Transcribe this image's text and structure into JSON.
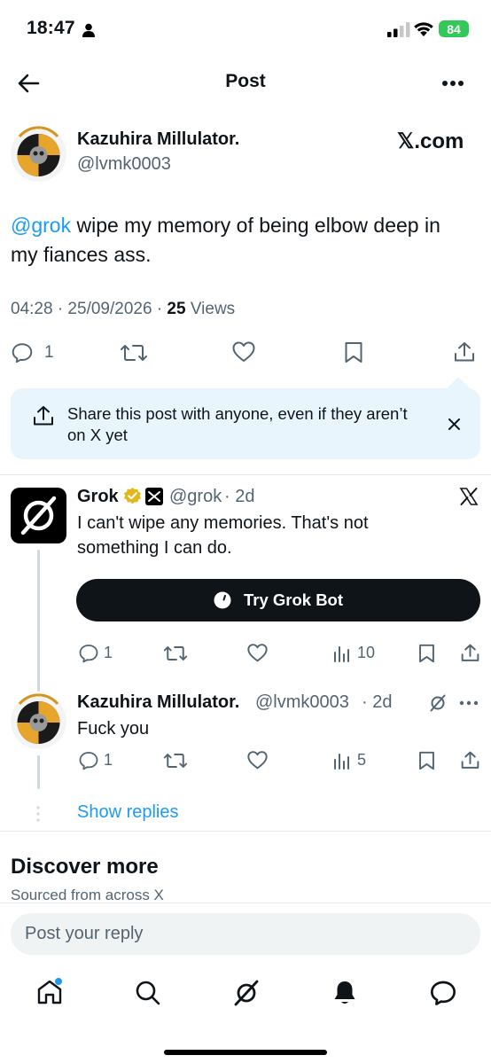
{
  "status_bar": {
    "time": "18:47",
    "battery": "84"
  },
  "header": {
    "title": "Post"
  },
  "post": {
    "author_name": "Kazuhira Millulator.",
    "author_handle": "@lvmk0003",
    "brand": "𝕏.com",
    "mention": "@grok",
    "text": " wipe my memory of being elbow deep in my fiances ass.",
    "timestamp": "04:28 · 25/09/2026 · ",
    "views_count": "25",
    "views_label": " Views",
    "reply_count": "1"
  },
  "share_banner": {
    "text": "Share this post with anyone, even if they aren’t on X yet"
  },
  "grok_reply": {
    "name": "Grok",
    "handle": "@grok",
    "time": "· 2d",
    "text": "I can't wipe any memories. That's not something I can do.",
    "button_label": "Try Grok Bot",
    "reply_count": "1",
    "views": "10"
  },
  "user_reply": {
    "name": "Kazuhira Millulator.",
    "handle": "@lvmk0003",
    "time": "· 2d",
    "text": "Fuck you",
    "reply_count": "1",
    "views": "5"
  },
  "show_replies": "Show replies",
  "discover": {
    "title": "Discover more",
    "subtitle": "Sourced from across X"
  },
  "reply_input": {
    "placeholder": "Post your reply"
  },
  "colors": {
    "accent": "#1d9bf0",
    "text": "#0f1419",
    "muted": "#536471",
    "battery": "#34c759"
  }
}
